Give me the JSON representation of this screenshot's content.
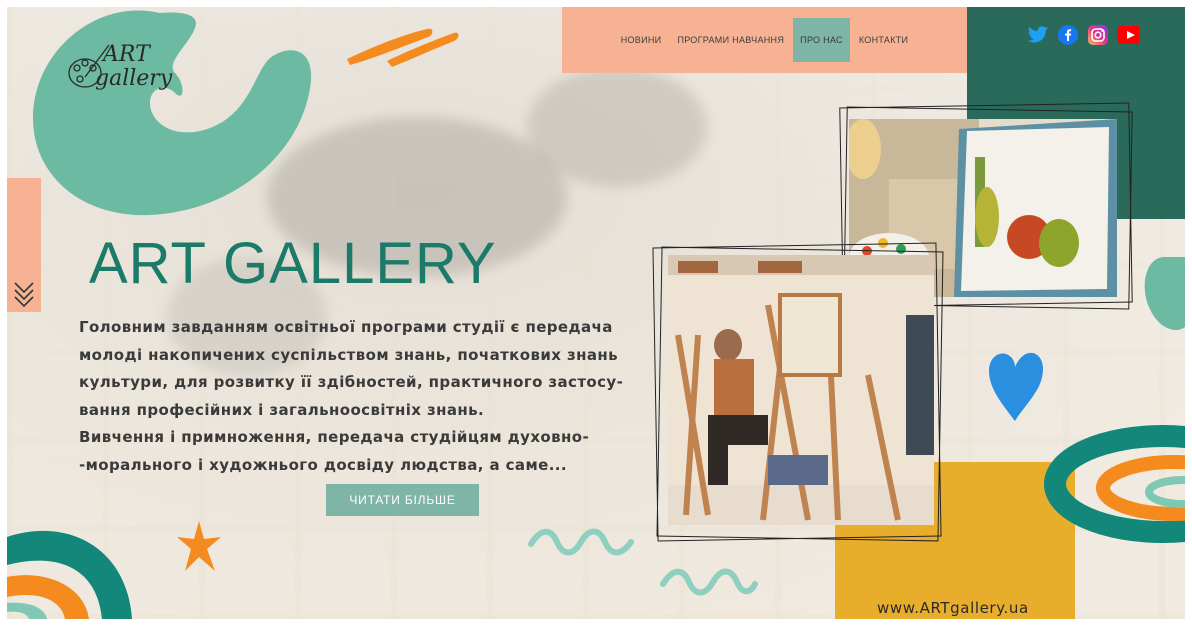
{
  "nav": {
    "items": [
      {
        "label": "НОВИНИ",
        "active": false
      },
      {
        "label": "ПРОГРАМИ НАВЧАННЯ",
        "active": false
      },
      {
        "label": "ПРО НАС",
        "active": true
      },
      {
        "label": "КОНТАКТИ",
        "active": false
      }
    ]
  },
  "socials": [
    "twitter-icon",
    "facebook-icon",
    "instagram-icon",
    "youtube-icon"
  ],
  "logo": {
    "line1": "ART",
    "line2": "gallery"
  },
  "hero": {
    "title": "ART GALLERY",
    "paragraph_lines": [
      "Головним завданням освітньої програми студії є передача",
      "молоді накопичених суспільством знань, початкових знань",
      "культури, для розвитку її здібностей, практичного застосу-",
      "вання професійних і загальноосвітніх знань.",
      "Вивчення і примноження, передача студійцям духовно-",
      "-морального і художнього досвіду людства, а саме..."
    ],
    "read_more": "ЧИТАТИ БІЛЬШЕ"
  },
  "footer": {
    "url": "www.ARTgallery.ua"
  },
  "colors": {
    "peach": "#f6b293",
    "teal_dark": "#2a6a5b",
    "teal": "#1b7a68",
    "mint": "#7fb5a6",
    "yellow": "#e9ad2c",
    "orange": "#f58a1f",
    "blue": "#2b8fe0"
  }
}
